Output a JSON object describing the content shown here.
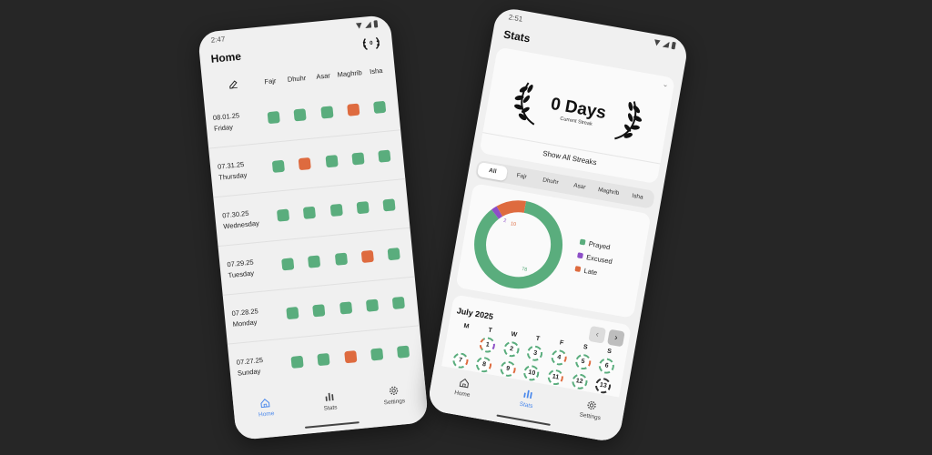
{
  "colors": {
    "prayed": "#5aad7d",
    "late": "#de6b3f",
    "excused": "#8d4fc7",
    "empty": "#dcdcdc",
    "accent": "#4b89ec"
  },
  "home_screen": {
    "status_time": "2:47",
    "title": "Home",
    "streak_badge": "0",
    "prayers": [
      "Fajr",
      "Dhuhr",
      "Asar",
      "Maghrib",
      "Isha"
    ],
    "days": [
      {
        "date": "08.01.25",
        "weekday": "Friday",
        "statuses": [
          "prayed",
          "prayed",
          "prayed",
          "late",
          "prayed"
        ]
      },
      {
        "date": "07.31.25",
        "weekday": "Thursday",
        "statuses": [
          "prayed",
          "late",
          "prayed",
          "prayed",
          "prayed"
        ]
      },
      {
        "date": "07.30.25",
        "weekday": "Wednesday",
        "statuses": [
          "prayed",
          "prayed",
          "prayed",
          "prayed",
          "prayed"
        ]
      },
      {
        "date": "07.29.25",
        "weekday": "Tuesday",
        "statuses": [
          "prayed",
          "prayed",
          "prayed",
          "late",
          "prayed"
        ]
      },
      {
        "date": "07.28.25",
        "weekday": "Monday",
        "statuses": [
          "prayed",
          "prayed",
          "prayed",
          "prayed",
          "prayed"
        ]
      },
      {
        "date": "07.27.25",
        "weekday": "Sunday",
        "statuses": [
          "prayed",
          "prayed",
          "late",
          "prayed",
          "prayed"
        ]
      }
    ],
    "nav": [
      {
        "label": "Home",
        "icon": "home-icon",
        "active": true
      },
      {
        "label": "Stats",
        "icon": "stats-icon",
        "active": false
      },
      {
        "label": "Settings",
        "icon": "gear-icon",
        "active": false
      }
    ]
  },
  "stats_screen": {
    "status_time": "2:51",
    "title": "Stats",
    "streak_value": "0 Days",
    "streak_caption": "Current Streak",
    "show_all_label": "Show All Streaks",
    "filter_tabs": [
      "All",
      "Fajr",
      "Dhuhr",
      "Asar",
      "Maghrib",
      "Isha"
    ],
    "active_filter": "All",
    "calendar_month": "July 2025",
    "weekdays": [
      "M",
      "T",
      "W",
      "T",
      "F",
      "S",
      "S"
    ],
    "calendar_days": [
      {
        "day": "",
        "style": "blank"
      },
      {
        "day": "1",
        "style": "mixed-excused"
      },
      {
        "day": "2",
        "style": "prayed"
      },
      {
        "day": "3",
        "style": "prayed"
      },
      {
        "day": "4",
        "style": "mixed-late"
      },
      {
        "day": "5",
        "style": "mixed-late"
      },
      {
        "day": "6",
        "style": "prayed"
      },
      {
        "day": "7",
        "style": "mixed-late"
      },
      {
        "day": "8",
        "style": "mixed-late"
      },
      {
        "day": "9",
        "style": "mixed-late"
      },
      {
        "day": "10",
        "style": "prayed"
      },
      {
        "day": "11",
        "style": "mixed-late"
      },
      {
        "day": "12",
        "style": "prayed"
      },
      {
        "day": "13",
        "style": "today"
      }
    ],
    "nav": [
      {
        "label": "Home",
        "icon": "home-icon",
        "active": false
      },
      {
        "label": "Stats",
        "icon": "stats-icon",
        "active": true
      },
      {
        "label": "Settings",
        "icon": "gear-icon",
        "active": false
      }
    ]
  },
  "chart_data": {
    "type": "pie",
    "categories": [
      "Prayed",
      "Excused",
      "Late"
    ],
    "values": [
      78,
      2,
      10
    ],
    "legend_position": "right"
  }
}
